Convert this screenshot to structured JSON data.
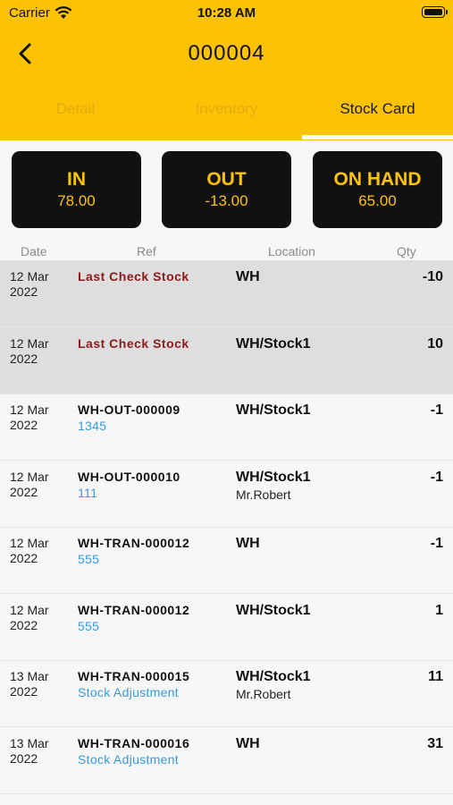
{
  "status": {
    "carrier": "Carrier",
    "time": "10:28 AM"
  },
  "nav": {
    "title": "000004",
    "back_icon": "chevron-left-icon"
  },
  "tabs": [
    {
      "label": "Detail",
      "active": false
    },
    {
      "label": "Inventory",
      "active": false
    },
    {
      "label": "Stock Card",
      "active": true
    }
  ],
  "summary": [
    {
      "label": "IN",
      "value": "78.00"
    },
    {
      "label": "OUT",
      "value": "-13.00"
    },
    {
      "label": "ON HAND",
      "value": "65.00"
    }
  ],
  "columns": {
    "date": "Date",
    "ref": "Ref",
    "location": "Location",
    "qty": "Qty"
  },
  "rows": [
    {
      "date1": "12 Mar",
      "date2": "2022",
      "ref": "Last Check Stock",
      "sub": "",
      "location": "WH",
      "person": "",
      "qty": "-10",
      "highlight": true
    },
    {
      "date1": "12 Mar",
      "date2": "2022",
      "ref": "Last Check Stock",
      "sub": "",
      "location": "WH/Stock1",
      "person": "",
      "qty": "10",
      "highlight": true
    },
    {
      "date1": "12 Mar",
      "date2": "2022",
      "ref": "WH-OUT-000009",
      "sub": "1345",
      "location": "WH/Stock1",
      "person": "",
      "qty": "-1",
      "highlight": false
    },
    {
      "date1": "12 Mar",
      "date2": "2022",
      "ref": "WH-OUT-000010",
      "sub": "111",
      "location": "WH/Stock1",
      "person": "Mr.Robert",
      "qty": "-1",
      "highlight": false
    },
    {
      "date1": "12 Mar",
      "date2": "2022",
      "ref": "WH-TRAN-000012",
      "sub": "555",
      "location": "WH",
      "person": "",
      "qty": "-1",
      "highlight": false
    },
    {
      "date1": "12 Mar",
      "date2": "2022",
      "ref": "WH-TRAN-000012",
      "sub": "555",
      "location": "WH/Stock1",
      "person": "",
      "qty": "1",
      "highlight": false
    },
    {
      "date1": "13 Mar",
      "date2": "2022",
      "ref": "WH-TRAN-000015",
      "sub": "Stock Adjustment",
      "location": "WH/Stock1",
      "person": "Mr.Robert",
      "qty": "11",
      "highlight": false
    },
    {
      "date1": "13 Mar",
      "date2": "2022",
      "ref": "WH-TRAN-000016",
      "sub": "Stock Adjustment",
      "location": "WH",
      "person": "",
      "qty": "31",
      "highlight": false
    }
  ],
  "colors": {
    "accent": "#fdc203",
    "ref_red": "#8b1a1a",
    "link_blue": "#3a9ad9"
  }
}
